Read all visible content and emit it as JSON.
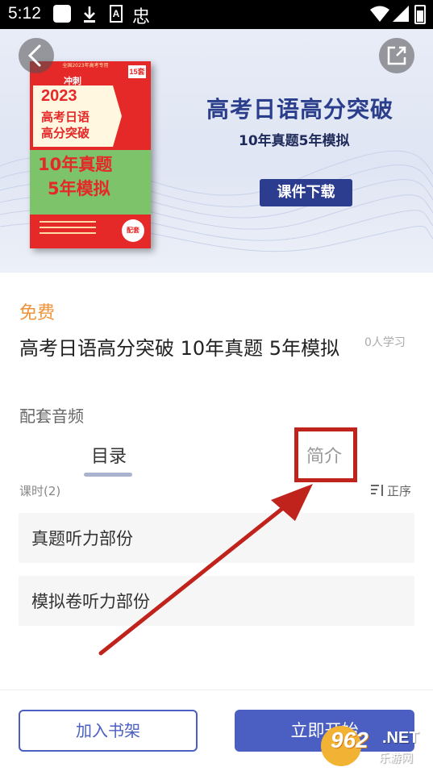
{
  "status_bar": {
    "time": "5:12",
    "a_icon_letter": "A",
    "bug_glyph": "忠",
    "icons": [
      "notification-square-icon",
      "download-icon",
      "a-box-icon",
      "debug-icon",
      "wifi-icon",
      "signal-icon",
      "battery-icon"
    ]
  },
  "banner": {
    "title": "高考日语高分突破",
    "subtitle": "10年真题5年模拟",
    "badge": "课件下载",
    "book": {
      "top_note": "全国2023年高考专用",
      "badge": "15套",
      "chong": "冲刺",
      "year": "2023",
      "title_line1": "高考日语",
      "title_line2": "高分突破",
      "green_line1": "10年真题",
      "green_line2": "5年模拟",
      "seal": "配套"
    }
  },
  "course": {
    "price": "免费",
    "title": "高考日语高分突破 10年真题 5年模拟",
    "learners": "0人学习",
    "subtitle": "配套音频"
  },
  "tabs": [
    {
      "label": "目录",
      "active": true
    },
    {
      "label": "简介",
      "active": false
    }
  ],
  "lessons": {
    "count_label": "课时(2)",
    "sort_label": "正序",
    "items": [
      {
        "title": "真题听力部份"
      },
      {
        "title": "模拟卷听力部份"
      }
    ]
  },
  "bottom_bar": {
    "shelf_label": "加入书架",
    "start_label": "立即开始"
  },
  "watermark": {
    "number": "962",
    "net": ".NET",
    "site": "乐游网"
  },
  "colors": {
    "accent": "#4a5fc1",
    "price": "#f0933a",
    "annotation": "#c0231c",
    "banner_title": "#2b3e8c"
  }
}
